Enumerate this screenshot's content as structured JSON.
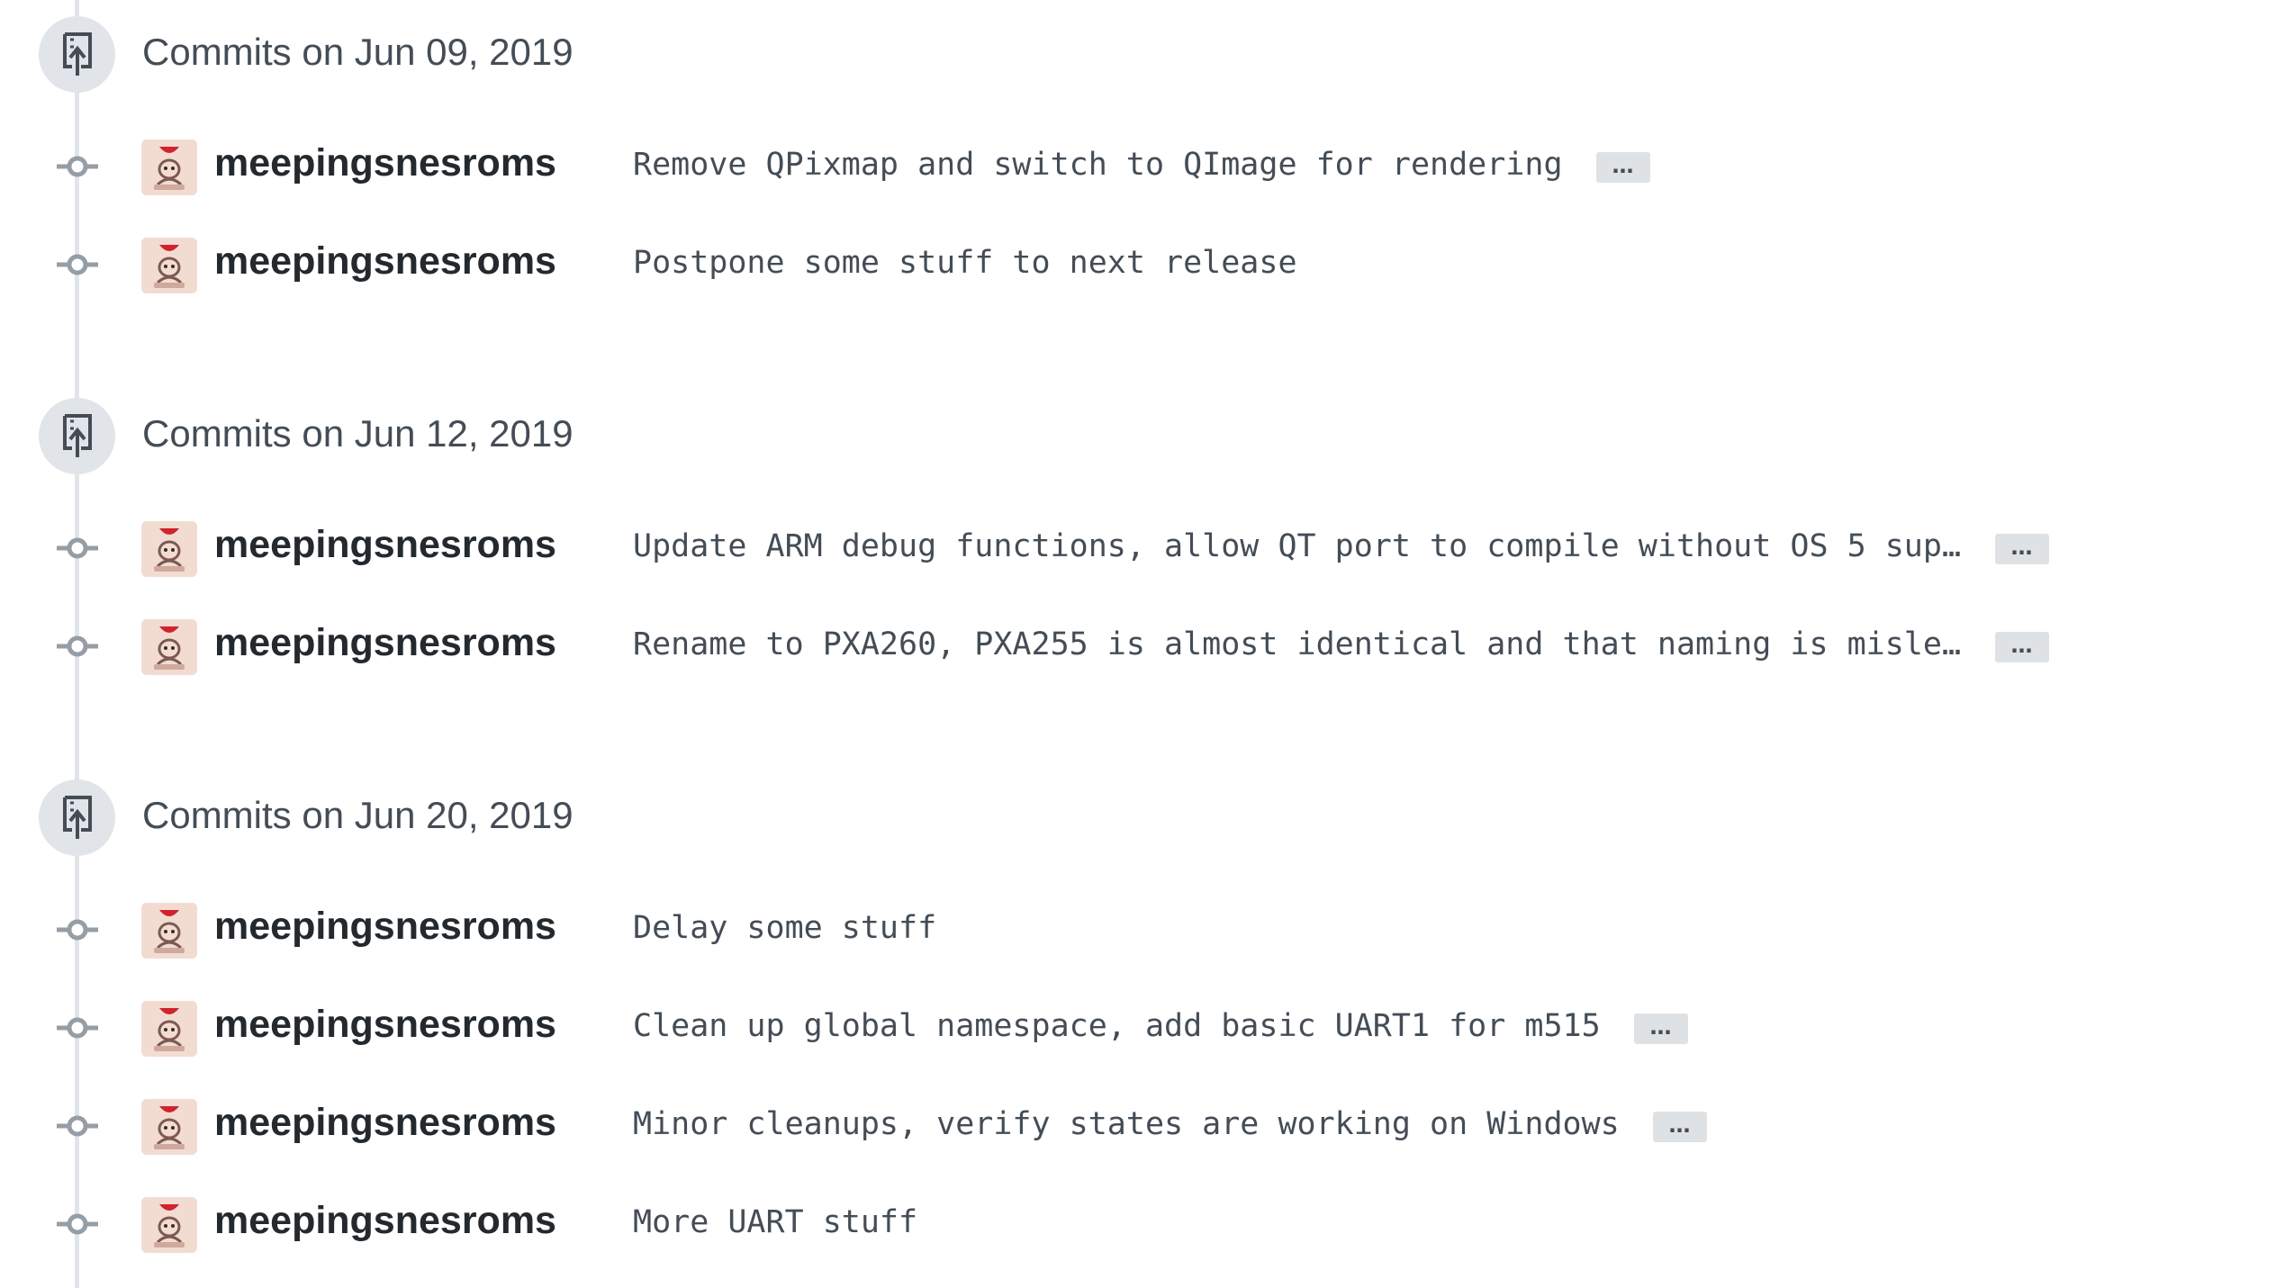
{
  "groups": [
    {
      "title": "Commits on Jun 09, 2019",
      "commits": [
        {
          "author": "meepingsnesroms",
          "message": "Remove QPixmap and switch to QImage for rendering",
          "expand": "…"
        },
        {
          "author": "meepingsnesroms",
          "message": "Postpone some stuff to next release",
          "expand": null
        }
      ]
    },
    {
      "title": "Commits on Jun 12, 2019",
      "commits": [
        {
          "author": "meepingsnesroms",
          "message": "Update ARM debug functions, allow QT port to compile without OS 5 sup…",
          "expand": "…"
        },
        {
          "author": "meepingsnesroms",
          "message": "Rename to PXA260, PXA255 is almost identical and that naming is misle…",
          "expand": "…"
        }
      ]
    },
    {
      "title": "Commits on Jun 20, 2019",
      "commits": [
        {
          "author": "meepingsnesroms",
          "message": "Delay some stuff",
          "expand": null
        },
        {
          "author": "meepingsnesroms",
          "message": "Clean up global namespace, add basic UART1 for m515",
          "expand": "…"
        },
        {
          "author": "meepingsnesroms",
          "message": "Minor cleanups, verify states are working on Windows",
          "expand": "…"
        },
        {
          "author": "meepingsnesroms",
          "message": "More UART stuff",
          "expand": null
        }
      ]
    }
  ],
  "colors": {
    "timeline": "#e1e4e8",
    "icon": "#444d56",
    "author": "#24292e",
    "message": "#444d56",
    "avatar_accent": "#d0232b"
  },
  "icons": {
    "group_header": "repo-push-icon",
    "commit_node": "git-commit-icon"
  }
}
